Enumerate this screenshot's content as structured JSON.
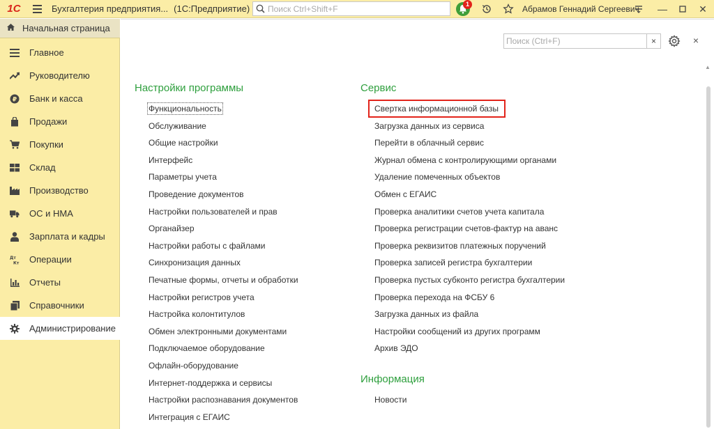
{
  "titlebar": {
    "logo": "1С",
    "app_title": "Бухгалтерия предприятия...",
    "app_sub": "(1С:Предприятие)",
    "search_placeholder": "Поиск Ctrl+Shift+F",
    "notification_count": "1",
    "user_name": "Абрамов Геннадий Сергеевич"
  },
  "sidebar": {
    "home": "Начальная страница",
    "items": [
      {
        "label": "Главное",
        "icon": "menu-icon"
      },
      {
        "label": "Руководителю",
        "icon": "trend-icon"
      },
      {
        "label": "Банк и касса",
        "icon": "coin-icon"
      },
      {
        "label": "Продажи",
        "icon": "bag-icon"
      },
      {
        "label": "Покупки",
        "icon": "cart-icon"
      },
      {
        "label": "Склад",
        "icon": "warehouse-icon"
      },
      {
        "label": "Производство",
        "icon": "factory-icon"
      },
      {
        "label": "ОС и НМА",
        "icon": "truck-icon"
      },
      {
        "label": "Зарплата и кадры",
        "icon": "person-icon"
      },
      {
        "label": "Операции",
        "icon": "debit-credit-icon"
      },
      {
        "label": "Отчеты",
        "icon": "report-icon"
      },
      {
        "label": "Справочники",
        "icon": "books-icon"
      },
      {
        "label": "Администрирование",
        "icon": "gear-icon"
      }
    ],
    "active_index": 12
  },
  "panel": {
    "search_placeholder": "Поиск (Ctrl+F)",
    "settings_title": "Настройки программы",
    "settings_links": [
      "Функциональность",
      "Обслуживание",
      "Общие настройки",
      "Интерфейс",
      "Параметры учета",
      "Проведение документов",
      "Настройки пользователей и прав",
      "Органайзер",
      "Настройки работы с файлами",
      "Синхронизация данных",
      "Печатные формы, отчеты и обработки",
      "Настройки регистров учета",
      "Настройка колонтитулов",
      "Обмен электронными документами",
      "Подключаемое оборудование",
      "Офлайн-оборудование",
      "Интернет-поддержка и сервисы",
      "Настройки распознавания документов",
      "Интеграция с ЕГАИС"
    ],
    "service_title": "Сервис",
    "service_links": [
      "Свертка информационной базы",
      "Загрузка данных из сервиса",
      "Перейти в облачный сервис",
      "Журнал обмена с контролирующими органами",
      "Удаление помеченных объектов",
      "Обмен с ЕГАИС",
      "Проверка аналитики счетов учета капитала",
      "Проверка регистрации счетов-фактур на аванс",
      "Проверка реквизитов платежных поручений",
      "Проверка записей регистра бухгалтерии",
      "Проверка пустых субконто регистра бухгалтерии",
      "Проверка перехода на ФСБУ 6",
      "Загрузка данных из файла",
      "Настройки сообщений из других программ",
      "Архив ЭДО"
    ],
    "info_title": "Информация",
    "info_links": [
      "Новости"
    ],
    "highlight_color": "#e2231a",
    "accent_color": "#2e9f3d"
  }
}
